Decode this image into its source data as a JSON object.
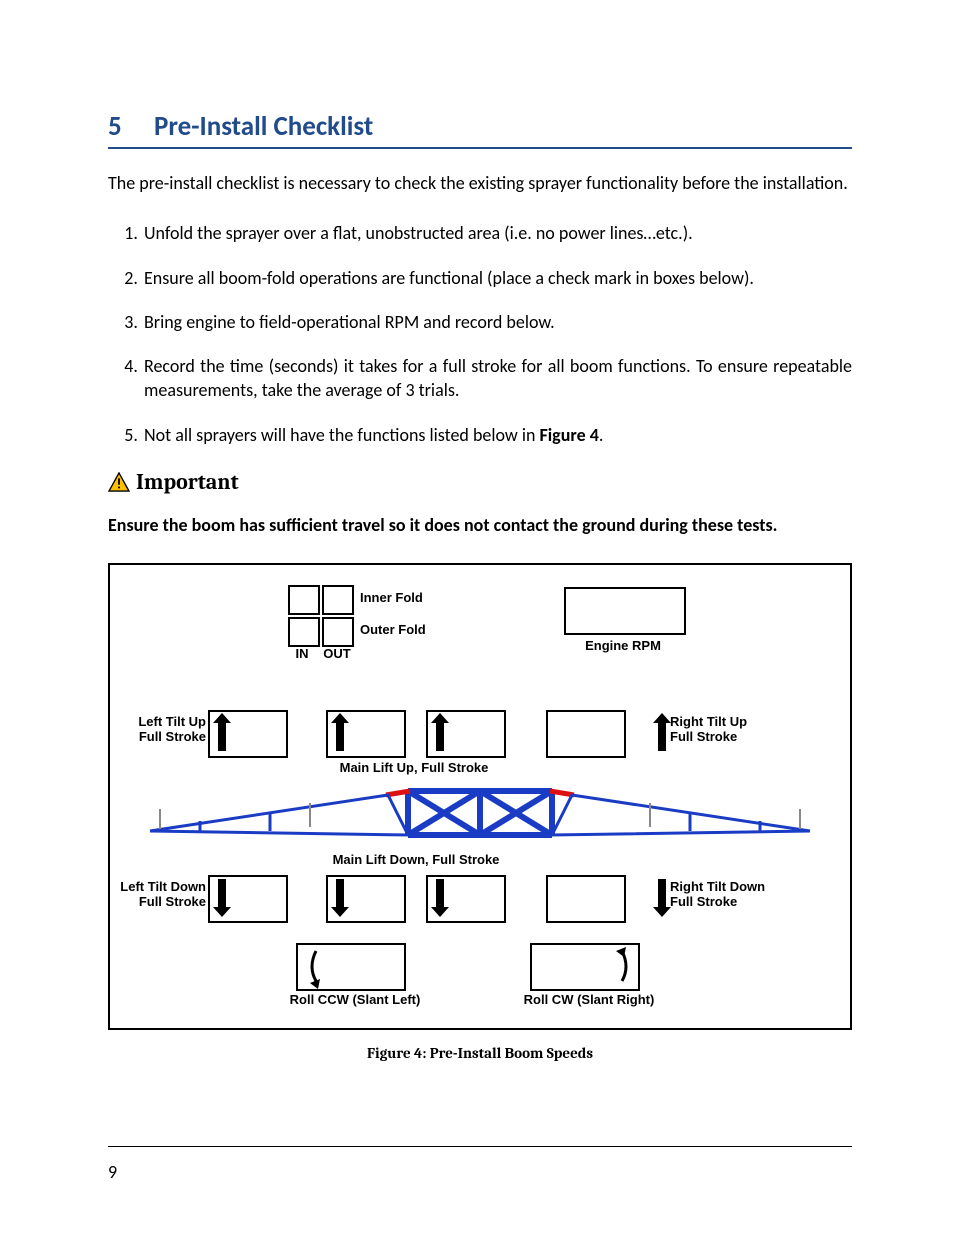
{
  "section_number": "5",
  "section_title": "Pre-Install Checklist",
  "intro": "The pre-install checklist is necessary to check the existing sprayer functionality before the installation.",
  "steps": [
    "Unfold the sprayer over a flat, unobstructed area (i.e. no power lines…etc.).",
    "Ensure all boom-fold operations are functional (place a check mark in boxes below).",
    "Bring engine to field-operational RPM and record below.",
    "Record the time (seconds) it takes for a full stroke for all boom functions.  To ensure repeatable measurements, take the average of 3 trials.",
    "Not all sprayers will have the functions listed below in "
  ],
  "step5_figref": "Figure 4",
  "step5_end": ".",
  "important_label": "Important",
  "important_text": "Ensure the boom has sufficient travel so it does not contact the ground during these tests.",
  "figure": {
    "inner_fold": "Inner Fold",
    "outer_fold": "Outer Fold",
    "in": "IN",
    "out": "OUT",
    "engine_rpm": "Engine RPM",
    "left_tilt_up": "Left Tilt Up\nFull Stroke",
    "right_tilt_up": "Right Tilt Up\nFull Stroke",
    "main_lift_up": "Main Lift Up, Full Stroke",
    "main_lift_down": "Main Lift Down, Full Stroke",
    "left_tilt_down": "Left Tilt Down\nFull Stroke",
    "right_tilt_down": "Right Tilt  Down\nFull Stroke",
    "roll_ccw": "Roll CCW (Slant Left)",
    "roll_cw": "Roll CW (Slant Right)"
  },
  "figure_caption": "Figure 4: Pre-Install Boom Speeds",
  "page_number": "9"
}
